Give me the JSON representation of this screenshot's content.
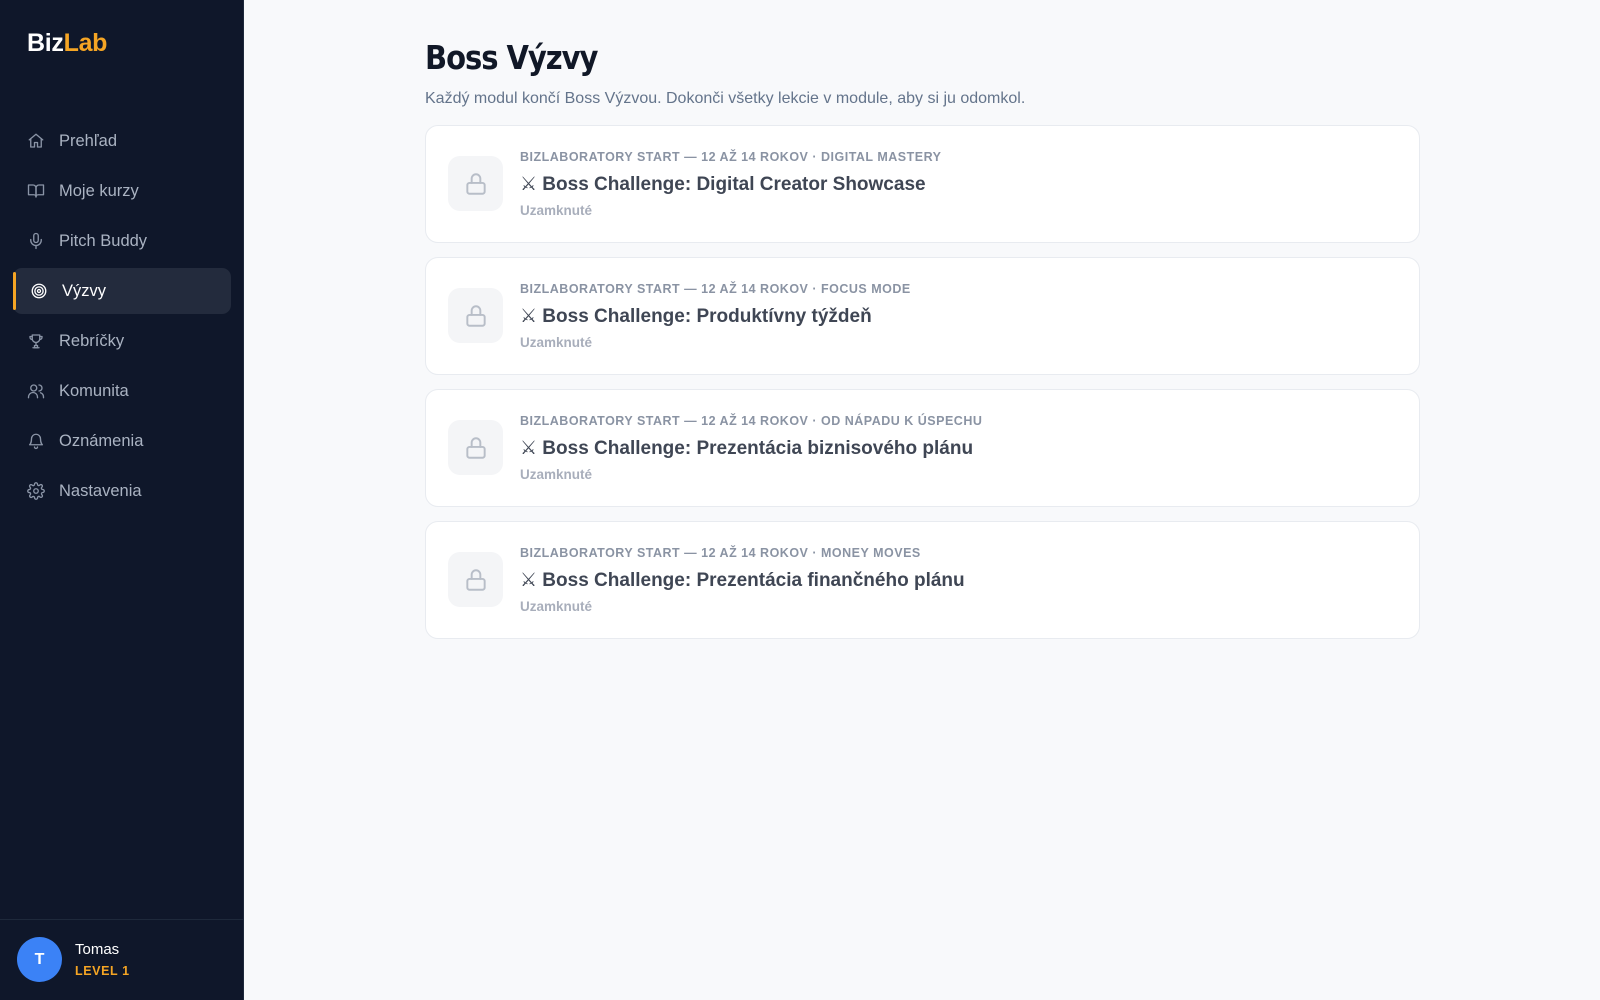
{
  "brand": {
    "part1": "Biz",
    "part2": "Lab"
  },
  "nav": {
    "items": [
      {
        "label": "Prehľad",
        "icon": "home-icon"
      },
      {
        "label": "Moje kurzy",
        "icon": "book-icon"
      },
      {
        "label": "Pitch Buddy",
        "icon": "microphone-icon"
      },
      {
        "label": "Výzvy",
        "icon": "target-icon",
        "active": true
      },
      {
        "label": "Rebríčky",
        "icon": "trophy-icon"
      },
      {
        "label": "Komunita",
        "icon": "users-icon"
      },
      {
        "label": "Oznámenia",
        "icon": "bell-icon"
      },
      {
        "label": "Nastavenia",
        "icon": "gear-icon"
      }
    ]
  },
  "user": {
    "initial": "T",
    "name": "Tomas",
    "level": "LEVEL 1"
  },
  "page": {
    "title": "Boss Výzvy",
    "subtitle": "Každý modul končí Boss Výzvou. Dokonči všetky lekcie v module, aby si ju odomkol."
  },
  "challenges": [
    {
      "meta": "BIZLABORATORY START — 12 AŽ 14 ROKOV · DIGITAL MASTERY",
      "title": "⚔ Boss Challenge: Digital Creator Showcase",
      "status": "Uzamknuté",
      "icon": "lock-icon"
    },
    {
      "meta": "BIZLABORATORY START — 12 AŽ 14 ROKOV · FOCUS MODE",
      "title": "⚔ Boss Challenge: Produktívny týždeň",
      "status": "Uzamknuté",
      "icon": "lock-icon"
    },
    {
      "meta": "BIZLABORATORY START — 12 AŽ 14 ROKOV · OD NÁPADU K ÚSPECHU",
      "title": "⚔ Boss Challenge: Prezentácia biznisového plánu",
      "status": "Uzamknuté",
      "icon": "lock-icon"
    },
    {
      "meta": "BIZLABORATORY START — 12 AŽ 14 ROKOV · MONEY MOVES",
      "title": "⚔ Boss Challenge: Prezentácia finančného plánu",
      "status": "Uzamknuté",
      "icon": "lock-icon"
    }
  ],
  "colors": {
    "sidebar_bg": "#0f172a",
    "accent": "#f5a524",
    "avatar": "#3b82f6",
    "page_bg": "#f8f9fb"
  }
}
